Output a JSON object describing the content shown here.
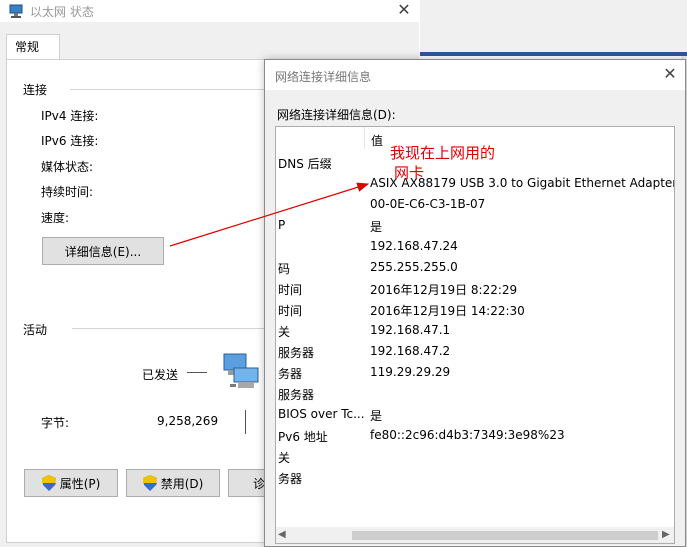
{
  "status_window": {
    "title": "以太网 状态",
    "tab": "常规",
    "connection_group": "连接",
    "fields": [
      "IPv4 连接:",
      "IPv6 连接:",
      "媒体状态:",
      "持续时间:",
      "速度:"
    ],
    "details_button": "详细信息(E)...",
    "activity_group": "活动",
    "sent_label": "已发送",
    "bytes_label": "字节:",
    "bytes_sent": "9,258,269",
    "buttons": {
      "properties": "属性(P)",
      "disable": "禁用(D)",
      "diagnose": "诊"
    }
  },
  "details_dialog": {
    "title": "网络连接详细信息",
    "caption": "网络连接详细信息(D):",
    "value_header": "值",
    "rows": [
      {
        "prop": "DNS 后缀",
        "value": ""
      },
      {
        "prop": "",
        "value": "ASIX AX88179 USB 3.0 to Gigabit Ethernet Adapter"
      },
      {
        "prop": "",
        "value": "00-0E-C6-C3-1B-07"
      },
      {
        "prop": "P",
        "value": "是"
      },
      {
        "prop": "",
        "value": "192.168.47.24"
      },
      {
        "prop": "码",
        "value": "255.255.255.0"
      },
      {
        "prop": "时间",
        "value": "2016年12月19日 8:22:29"
      },
      {
        "prop": "时间",
        "value": "2016年12月19日 14:22:30"
      },
      {
        "prop": "关",
        "value": "192.168.47.1"
      },
      {
        "prop": "服务器",
        "value": "192.168.47.2"
      },
      {
        "prop": "务器",
        "value": "119.29.29.29"
      },
      {
        "prop": "服务器",
        "value": ""
      },
      {
        "prop": "BIOS over Tc...",
        "value": "是"
      },
      {
        "prop": "Pv6 地址",
        "value": "fe80::2c96:d4b3:7349:3e98%23"
      },
      {
        "prop": "关",
        "value": ""
      },
      {
        "prop": "务器",
        "value": ""
      }
    ]
  },
  "annotation": {
    "text_line1": "我现在上网用的",
    "text_line2": "网卡"
  },
  "colors": {
    "annotation": "#e00000",
    "accent": "#2b579a",
    "button_face": "#e1e1e1"
  },
  "icons": [
    "network-adapter-icon",
    "close-icon",
    "shield-icon",
    "network-computers-icon"
  ]
}
